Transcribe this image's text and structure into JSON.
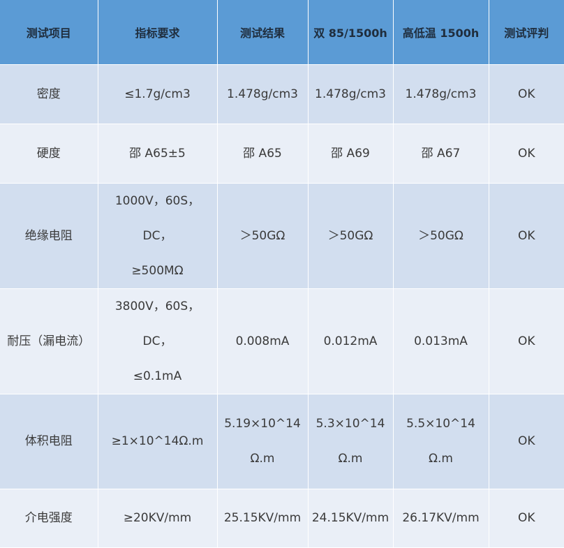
{
  "headers": [
    "测试项目",
    "指标要求",
    "测试结果",
    "双 85/1500h",
    "高低温 1500h",
    "测试评判"
  ],
  "rows": [
    {
      "item": "密度",
      "requirement": [
        "≤1.7g/cm3"
      ],
      "result": [
        "1.478g/cm3"
      ],
      "double85": [
        "1.478g/cm3"
      ],
      "highlow": [
        "1.478g/cm3"
      ],
      "verdict": "OK"
    },
    {
      "item": "硬度",
      "requirement": [
        "邵 A65±5"
      ],
      "result": [
        "邵 A65"
      ],
      "double85": [
        "邵 A69"
      ],
      "highlow": [
        "邵 A67"
      ],
      "verdict": "OK"
    },
    {
      "item": "绝缘电阻",
      "requirement": [
        "1000V，60S，DC，",
        "≥500MΩ"
      ],
      "result": [
        "＞50GΩ"
      ],
      "double85": [
        "＞50GΩ"
      ],
      "highlow": [
        "＞50GΩ"
      ],
      "verdict": "OK"
    },
    {
      "item": "耐压（漏电流）",
      "requirement": [
        "3800V，60S，DC，",
        "≤0.1mA"
      ],
      "result": [
        "0.008mA"
      ],
      "double85": [
        "0.012mA"
      ],
      "highlow": [
        "0.013mA"
      ],
      "verdict": "OK"
    },
    {
      "item": "体积电阻",
      "requirement": [
        "≥1×10^14Ω.m"
      ],
      "result": [
        "5.19×10^14",
        "Ω.m"
      ],
      "double85": [
        "5.3×10^14",
        "Ω.m"
      ],
      "highlow": [
        "5.5×10^14",
        "Ω.m"
      ],
      "verdict": "OK"
    },
    {
      "item": "介电强度",
      "requirement": [
        "≥20KV/mm"
      ],
      "result": [
        "25.15KV/mm"
      ],
      "double85": [
        "24.15KV/mm"
      ],
      "highlow": [
        "26.17KV/mm"
      ],
      "verdict": "OK"
    }
  ]
}
